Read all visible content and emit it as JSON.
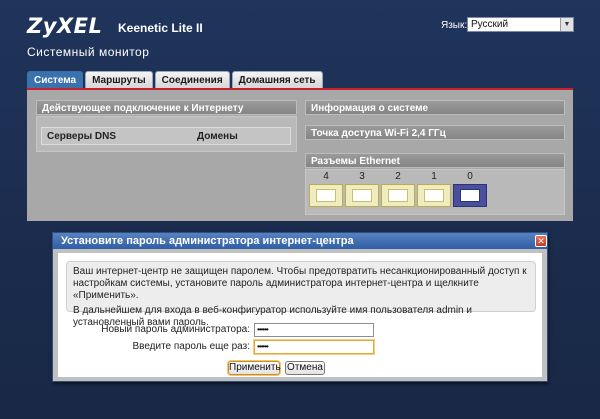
{
  "header": {
    "logo": "ZyXEL",
    "model": "Keenetic Lite II",
    "page_title": "Системный монитор",
    "language_label": "Язык:",
    "language_selected": "Русский"
  },
  "tabs": [
    {
      "label": "Система",
      "active": true
    },
    {
      "label": "Маршруты",
      "active": false
    },
    {
      "label": "Соединения",
      "active": false
    },
    {
      "label": "Домашняя сеть",
      "active": false
    }
  ],
  "sections": {
    "current_connection": "Действующее подключение к Интернету",
    "system_info": "Информация о системе",
    "wifi_ap": "Точка доступа Wi-Fi 2,4 ГГц",
    "ethernet_ports": "Разъемы Ethernet"
  },
  "dns_table": {
    "col1": "Серверы DNS",
    "col2": "Домены"
  },
  "ports": [
    {
      "label": "4",
      "active": false
    },
    {
      "label": "3",
      "active": false
    },
    {
      "label": "2",
      "active": false
    },
    {
      "label": "1",
      "active": false
    },
    {
      "label": "0",
      "active": true
    }
  ],
  "dialog": {
    "title": "Установите пароль администратора интернет-центра",
    "message1": "Ваш интернет-центр не защищен паролем. Чтобы предотвратить несанкционированный доступ к настройкам системы, установите пароль администратора интернет-центра и щелкните «Применить».",
    "message2": "В дальнейшем для входа в веб-конфигуратор используйте имя пользователя admin и установленный вами пароль.",
    "new_password_label": "Новый пароль администратора:",
    "new_password_value": "••••••",
    "confirm_password_label": "Введите пароль еще раз:",
    "confirm_password_value": "••••••",
    "apply_label": "Применить",
    "cancel_label": "Отмена"
  },
  "colors": {
    "background": "#1d2f52",
    "active_tab": "#3a72ad",
    "accent_line": "#c8202c",
    "dialog_title": "#2f5fa5"
  }
}
